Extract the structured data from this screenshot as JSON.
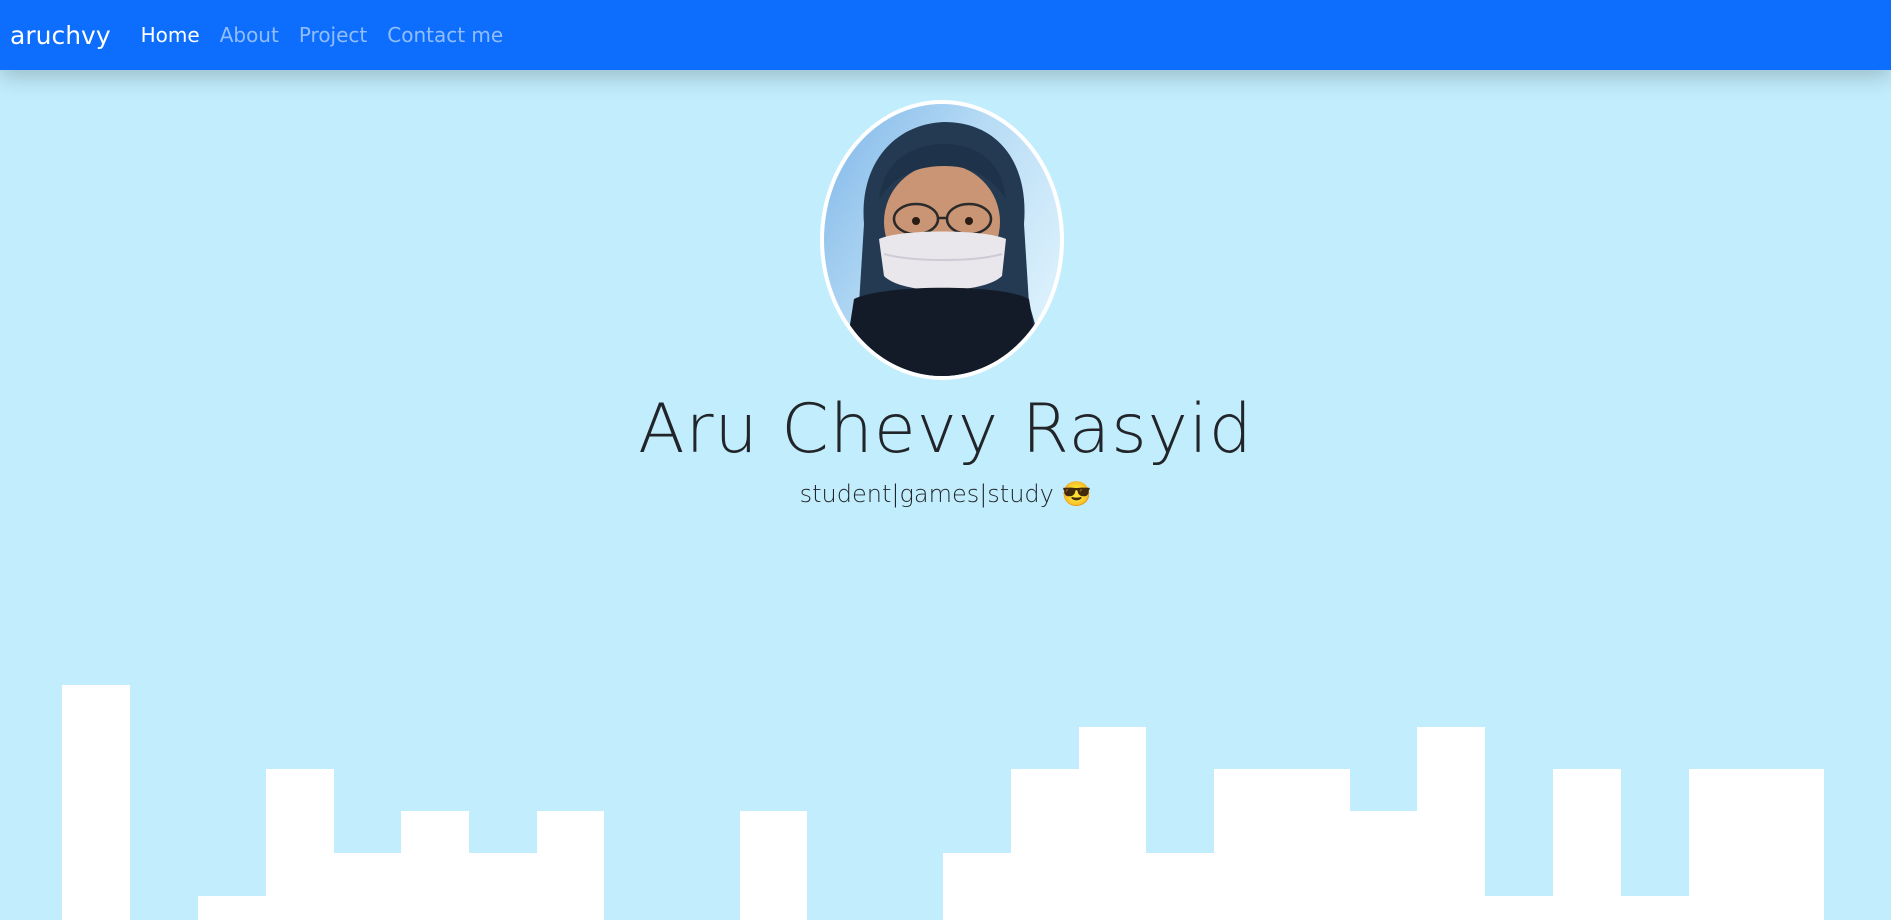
{
  "navbar": {
    "brand": "aruchvy",
    "links": [
      {
        "label": "Home",
        "active": true
      },
      {
        "label": "About",
        "active": false
      },
      {
        "label": "Project",
        "active": false
      },
      {
        "label": "Contact me",
        "active": false
      }
    ]
  },
  "hero": {
    "name": "Aru Chevy Rasyid",
    "tagline": "student|games|study 😎",
    "avatar_icon": "profile-photo"
  },
  "colors": {
    "navbar_bg": "#0d6efd",
    "page_bg": "#c2edfd",
    "wave_fill": "#ffffff",
    "text": "#212529"
  }
}
